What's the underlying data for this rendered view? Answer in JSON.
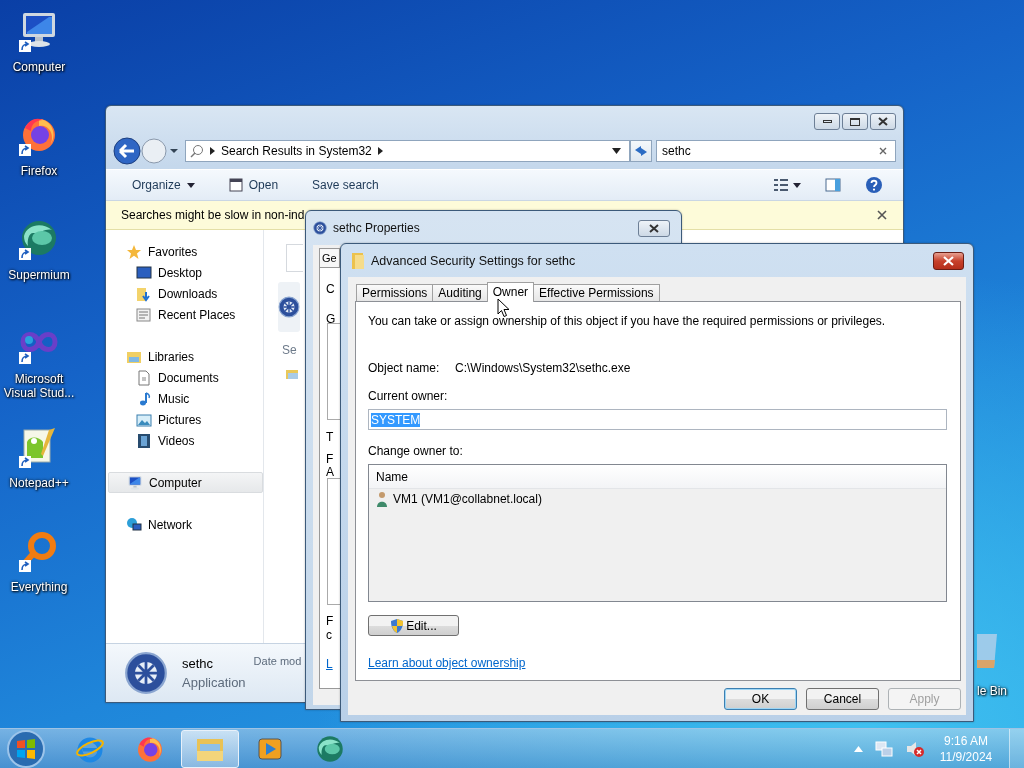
{
  "desktop_icons": [
    {
      "label": "Computer",
      "kind": "computer"
    },
    {
      "label": "Firefox",
      "kind": "firefox"
    },
    {
      "label": "Supermium",
      "kind": "supermium"
    },
    {
      "label": "Microsoft Visual Stud...",
      "kind": "vs"
    },
    {
      "label": "Notepad++",
      "kind": "notepad"
    },
    {
      "label": "Everything",
      "kind": "everything"
    }
  ],
  "recycle_bin": {
    "label": "le Bin"
  },
  "explorer": {
    "address": "Search Results in System32",
    "search_value": "sethc",
    "toolbar": [
      {
        "label": "Organize",
        "kind": "menu"
      },
      {
        "label": "Open",
        "kind": "open"
      },
      {
        "label": "Save search",
        "kind": "plain"
      }
    ],
    "info_bar": "Searches might be slow in non-ind",
    "nav": [
      {
        "label": "Favorites",
        "kind": "star",
        "selected": false,
        "children": [
          {
            "label": "Desktop",
            "kind": "desktop",
            "selected": false
          },
          {
            "label": "Downloads",
            "kind": "downloads",
            "selected": false
          },
          {
            "label": "Recent Places",
            "kind": "recent",
            "selected": false
          }
        ]
      },
      {
        "label": "Libraries",
        "kind": "libraries",
        "selected": false,
        "children": [
          {
            "label": "Documents",
            "kind": "documents",
            "selected": false
          },
          {
            "label": "Music",
            "kind": "music",
            "selected": false
          },
          {
            "label": "Pictures",
            "kind": "pictures",
            "selected": false
          },
          {
            "label": "Videos",
            "kind": "videos",
            "selected": false
          }
        ]
      },
      {
        "label": "Computer",
        "kind": "computer",
        "selected": true
      },
      {
        "label": "Network",
        "kind": "network",
        "selected": false
      }
    ],
    "content_fragment": "Se",
    "details": {
      "name": "sethc",
      "type": "Application",
      "date_label": "Date mod"
    }
  },
  "properties": {
    "title": "sethc Properties",
    "tab": "Ge",
    "fragments": [
      "C",
      "G",
      "T",
      "F",
      "A",
      "F",
      "c"
    ],
    "link_fragment": "L"
  },
  "advanced": {
    "title": "Advanced Security Settings for sethc",
    "tabs": [
      {
        "label": "Permissions",
        "selected": false
      },
      {
        "label": "Auditing",
        "selected": false
      },
      {
        "label": "Owner",
        "selected": true
      },
      {
        "label": "Effective Permissions",
        "selected": false
      }
    ],
    "intro": "You can take or assign ownership of this object if you have the required permissions or privileges.",
    "object_label": "Object name:",
    "object_value": "C:\\Windows\\System32\\sethc.exe",
    "current_owner_label": "Current owner:",
    "current_owner_value": "SYSTEM",
    "current_owner_text_selected": true,
    "change_label": "Change owner to:",
    "column": "Name",
    "rows": [
      {
        "name": "VM1 (VM1@collabnet.local)",
        "selected": false
      }
    ],
    "edit_button": "Edit...",
    "link": "Learn about object ownership",
    "buttons": [
      {
        "label": "OK",
        "kind": "default",
        "disabled": false
      },
      {
        "label": "Cancel",
        "kind": "normal",
        "disabled": false
      },
      {
        "label": "Apply",
        "kind": "normal",
        "disabled": true
      }
    ]
  },
  "taskbar": {
    "apps": [
      {
        "kind": "ie",
        "active": false
      },
      {
        "kind": "firefox",
        "active": false
      },
      {
        "kind": "explorer",
        "active": true
      },
      {
        "kind": "media",
        "active": false
      },
      {
        "kind": "supermium",
        "active": false
      }
    ],
    "time": "9:16 AM",
    "date": "11/9/2024",
    "volume_muted": true
  }
}
